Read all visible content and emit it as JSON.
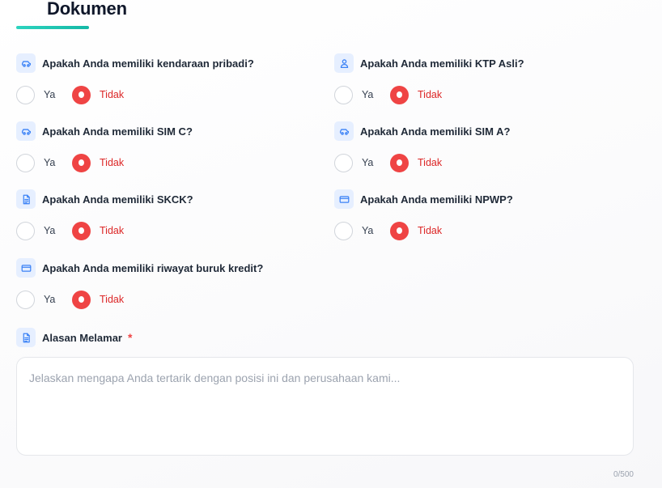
{
  "section": {
    "title": "Dokumen"
  },
  "questions": [
    {
      "label": "Apakah Anda memiliki kendaraan pribadi?",
      "icon": "car-icon",
      "yes": "Ya",
      "no": "Tidak",
      "selected": "Tidak"
    },
    {
      "label": "Apakah Anda memiliki KTP Asli?",
      "icon": "user-icon",
      "yes": "Ya",
      "no": "Tidak",
      "selected": "Tidak"
    },
    {
      "label": "Apakah Anda memiliki SIM C?",
      "icon": "car-icon",
      "yes": "Ya",
      "no": "Tidak",
      "selected": "Tidak"
    },
    {
      "label": "Apakah Anda memiliki SIM A?",
      "icon": "car-icon",
      "yes": "Ya",
      "no": "Tidak",
      "selected": "Tidak"
    },
    {
      "label": "Apakah Anda memiliki SKCK?",
      "icon": "document-icon",
      "yes": "Ya",
      "no": "Tidak",
      "selected": "Tidak"
    },
    {
      "label": "Apakah Anda memiliki NPWP?",
      "icon": "card-icon",
      "yes": "Ya",
      "no": "Tidak",
      "selected": "Tidak"
    },
    {
      "label": "Apakah Anda memiliki riwayat buruk kredit?",
      "icon": "card-icon",
      "yes": "Ya",
      "no": "Tidak",
      "selected": "Tidak"
    }
  ],
  "reason": {
    "label": "Alasan Melamar",
    "required_mark": "*",
    "icon": "document-icon",
    "placeholder": "Jelaskan mengapa Anda tertarik dengan posisi ini dan perusahaan kami...",
    "value": "",
    "counter": "0/500"
  },
  "colors": {
    "accent": "#14b8a6",
    "selected": "#ef4444",
    "icon_bg": "#e6efff",
    "icon_fg": "#3b82f6"
  }
}
